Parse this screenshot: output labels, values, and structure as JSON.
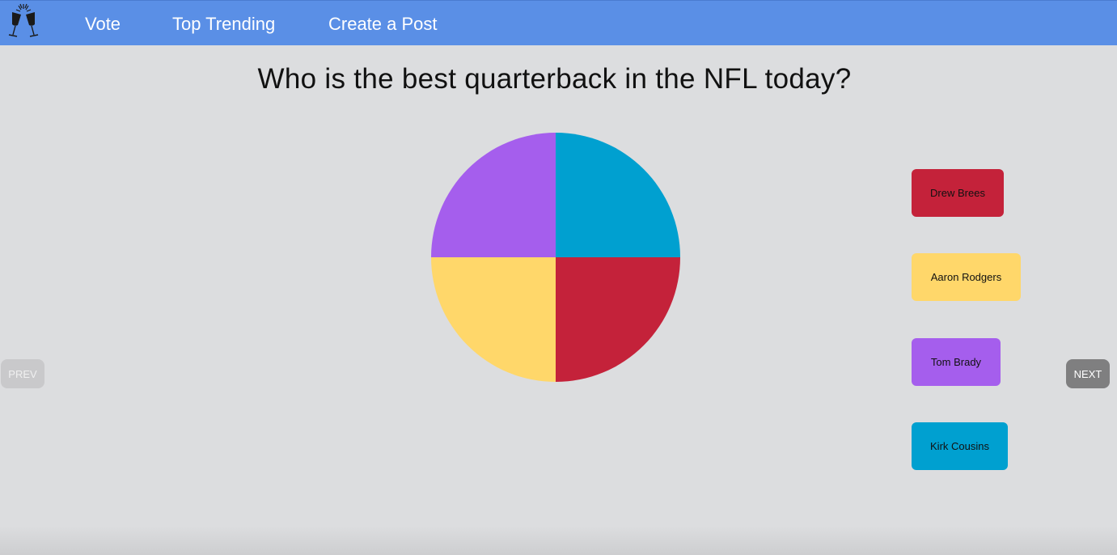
{
  "nav": {
    "items": [
      {
        "label": "Vote"
      },
      {
        "label": "Top Trending"
      },
      {
        "label": "Create a Post"
      }
    ]
  },
  "poll": {
    "question": "Who is the best quarterback in the NFL today?"
  },
  "chart_data": {
    "type": "pie",
    "categories": [
      "Kirk Cousins",
      "Drew Brees",
      "Aaron Rodgers",
      "Tom Brady"
    ],
    "values": [
      25,
      25,
      25,
      25
    ],
    "colors": [
      "#00a0d0",
      "#c4223a",
      "#ffd76a",
      "#a55eed"
    ],
    "start": "top",
    "direction": "clockwise"
  },
  "options": [
    {
      "label": "Drew Brees",
      "color": "#c4223a"
    },
    {
      "label": "Aaron Rodgers",
      "color": "#ffd76a"
    },
    {
      "label": "Tom Brady",
      "color": "#a55eed"
    },
    {
      "label": "Kirk Cousins",
      "color": "#00a0d0"
    }
  ],
  "pager": {
    "prev_label": "PREV",
    "next_label": "NEXT"
  }
}
